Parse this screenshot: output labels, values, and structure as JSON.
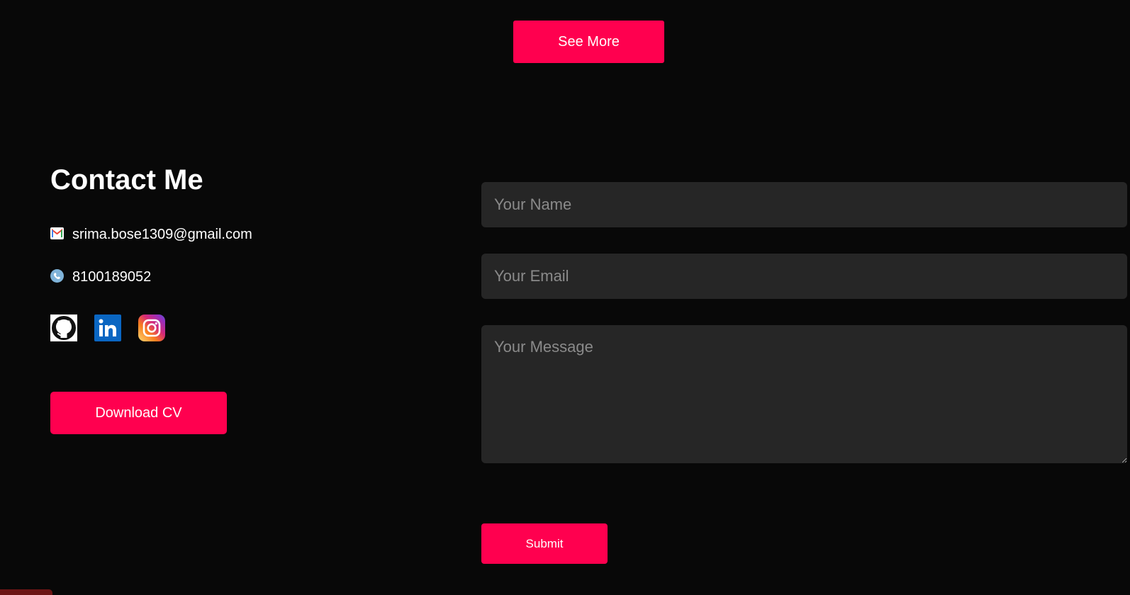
{
  "actions": {
    "see_more_label": "See More",
    "download_cv_label": "Download CV"
  },
  "contact": {
    "title": "Contact Me",
    "email": "srima.bose1309@gmail.com",
    "phone": "8100189052",
    "email_icon": "gmail-icon",
    "phone_icon": "phone-icon",
    "socials": [
      {
        "name": "github-icon"
      },
      {
        "name": "linkedin-icon"
      },
      {
        "name": "instagram-icon"
      }
    ]
  },
  "form": {
    "name_placeholder": "Your Name",
    "email_placeholder": "Your Email",
    "message_placeholder": "Your Message",
    "name_value": "",
    "email_value": "",
    "message_value": "",
    "submit_label": "Submit"
  },
  "colors": {
    "background": "#080808",
    "accent": "#ff004f",
    "field_bg": "#262626",
    "placeholder": "#8a8a8a"
  }
}
